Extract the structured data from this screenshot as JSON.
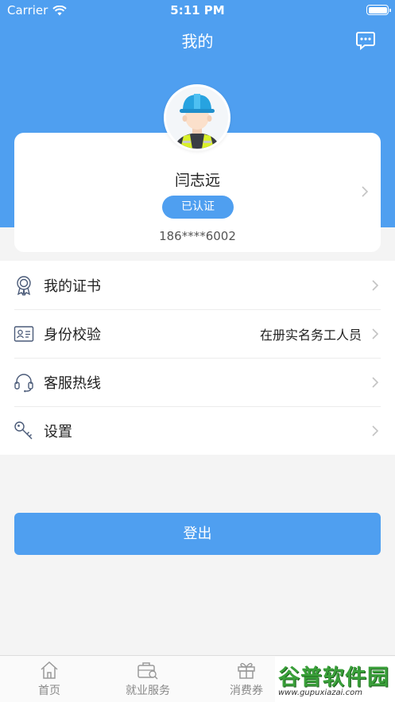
{
  "status_bar": {
    "carrier": "Carrier",
    "time": "5:11 PM"
  },
  "nav": {
    "title": "我的",
    "message_icon": "chat-bubble-icon"
  },
  "profile": {
    "name": "闫志远",
    "badge": "已认证",
    "phone": "186****6002",
    "avatar": "worker-avatar-icon"
  },
  "menu": {
    "items": [
      {
        "label": "我的证书",
        "value": "",
        "icon": "certificate-icon"
      },
      {
        "label": "身份校验",
        "value": "在册实名务工人员",
        "icon": "id-card-icon"
      },
      {
        "label": "客服热线",
        "value": "",
        "icon": "headset-icon"
      },
      {
        "label": "设置",
        "value": "",
        "icon": "key-icon"
      }
    ]
  },
  "logout_label": "登出",
  "tabbar": {
    "tabs": [
      {
        "label": "首页",
        "icon": "home-icon"
      },
      {
        "label": "就业服务",
        "icon": "briefcase-icon"
      },
      {
        "label": "消费券",
        "icon": "gift-icon"
      }
    ]
  },
  "watermark": {
    "text": "谷普软件园",
    "url": "www.gupuxiazai.com"
  },
  "colors": {
    "primary": "#4f9ff0",
    "background": "#f4f4f4"
  }
}
